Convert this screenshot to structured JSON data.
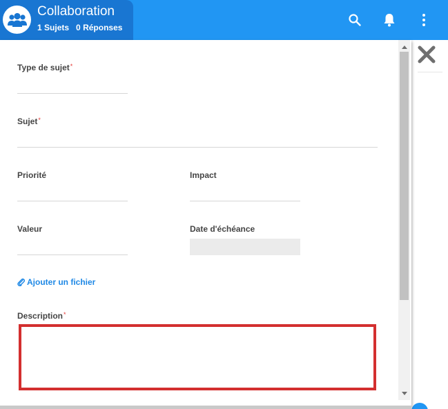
{
  "header": {
    "title": "Collaboration",
    "topics_count": "1",
    "topics_label": "Sujets",
    "replies_count": "0",
    "replies_label": "Réponses",
    "icons": [
      "users-icon",
      "search-icon",
      "bell-icon",
      "more-vertical-icon"
    ]
  },
  "form": {
    "topic_type_label": "Type de sujet",
    "subject_label": "Sujet",
    "priority_label": "Priorité",
    "impact_label": "Impact",
    "value_label": "Valeur",
    "due_date_label": "Date d'échéance",
    "attach_label": "Ajouter un fichier",
    "description_label": "Description",
    "required_mark": "*"
  },
  "colors": {
    "header_blue": "#2196f3",
    "header_dark_blue": "#1976d2",
    "highlight_red": "#d32f2f",
    "link_blue": "#1e88e5",
    "required_red": "#e53935"
  }
}
